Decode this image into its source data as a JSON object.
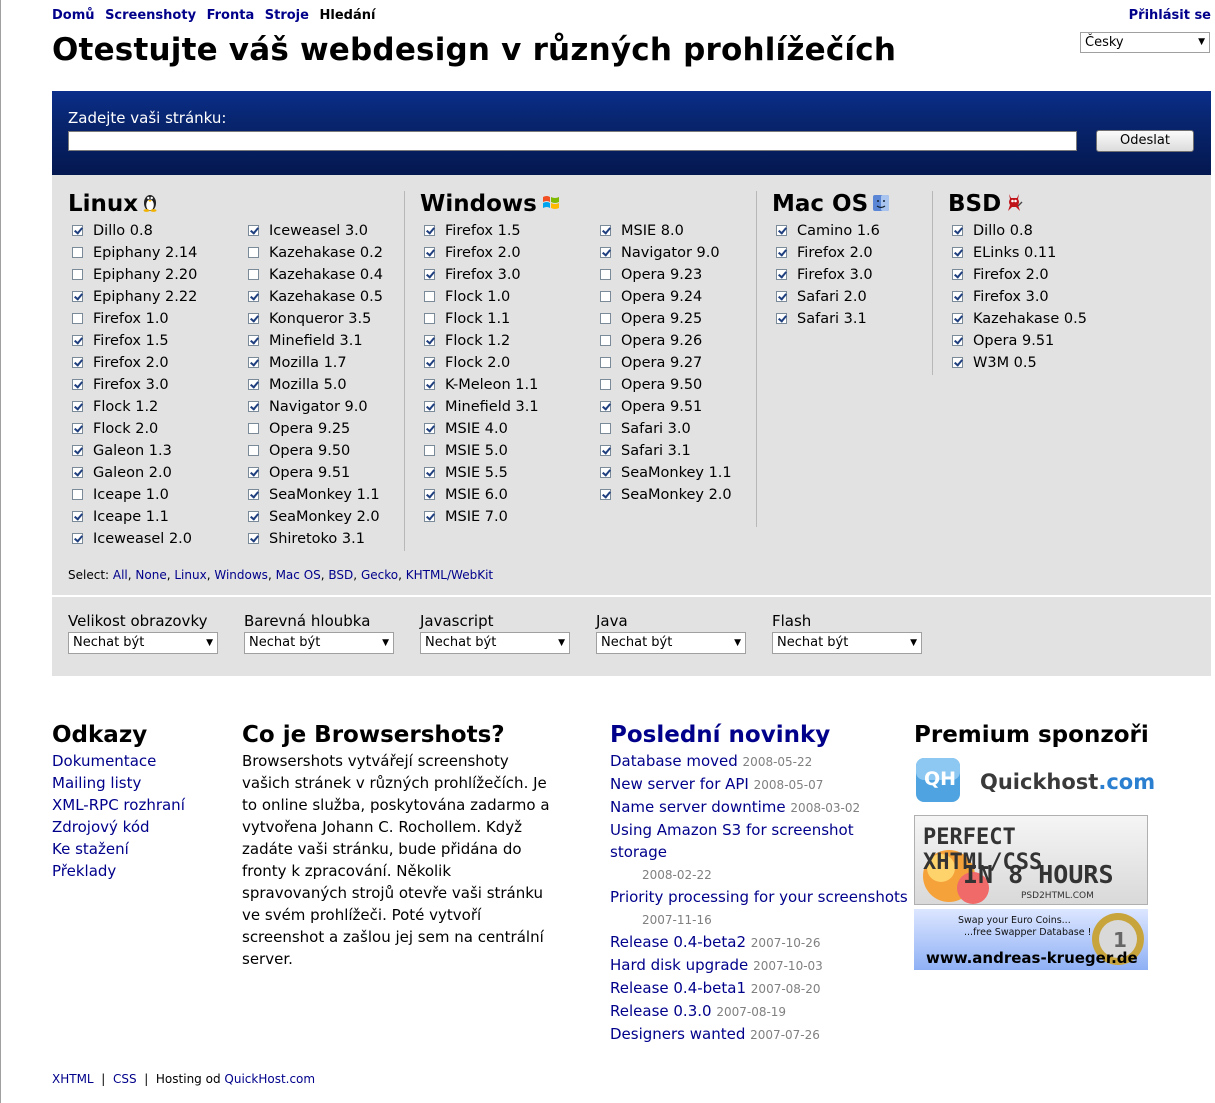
{
  "nav": {
    "items": [
      "Domů",
      "Screenshoty",
      "Fronta",
      "Stroje"
    ],
    "current": "Hledání",
    "login": "Přihlásit se"
  },
  "page_title": "Otestujte váš webdesign v různých prohlížečích",
  "language": {
    "selected": "Česky"
  },
  "url_form": {
    "label": "Zadejte vaši stránku:",
    "value": "",
    "submit": "Odeslat"
  },
  "platforms": {
    "linux": {
      "name": "Linux",
      "icon": "penguin-icon",
      "col1": [
        {
          "label": "Dillo 0.8",
          "checked": true
        },
        {
          "label": "Epiphany 2.14",
          "checked": false
        },
        {
          "label": "Epiphany 2.20",
          "checked": false
        },
        {
          "label": "Epiphany 2.22",
          "checked": true
        },
        {
          "label": "Firefox 1.0",
          "checked": false
        },
        {
          "label": "Firefox 1.5",
          "checked": true
        },
        {
          "label": "Firefox 2.0",
          "checked": true
        },
        {
          "label": "Firefox 3.0",
          "checked": true
        },
        {
          "label": "Flock 1.2",
          "checked": true
        },
        {
          "label": "Flock 2.0",
          "checked": true
        },
        {
          "label": "Galeon 1.3",
          "checked": true
        },
        {
          "label": "Galeon 2.0",
          "checked": true
        },
        {
          "label": "Iceape 1.0",
          "checked": false
        },
        {
          "label": "Iceape 1.1",
          "checked": true
        },
        {
          "label": "Iceweasel 2.0",
          "checked": true
        }
      ],
      "col2": [
        {
          "label": "Iceweasel 3.0",
          "checked": true
        },
        {
          "label": "Kazehakase 0.2",
          "checked": false
        },
        {
          "label": "Kazehakase 0.4",
          "checked": false
        },
        {
          "label": "Kazehakase 0.5",
          "checked": true
        },
        {
          "label": "Konqueror 3.5",
          "checked": true
        },
        {
          "label": "Minefield 3.1",
          "checked": true
        },
        {
          "label": "Mozilla 1.7",
          "checked": true
        },
        {
          "label": "Mozilla 5.0",
          "checked": true
        },
        {
          "label": "Navigator 9.0",
          "checked": true
        },
        {
          "label": "Opera 9.25",
          "checked": false
        },
        {
          "label": "Opera 9.50",
          "checked": false
        },
        {
          "label": "Opera 9.51",
          "checked": true
        },
        {
          "label": "SeaMonkey 1.1",
          "checked": true
        },
        {
          "label": "SeaMonkey 2.0",
          "checked": true
        },
        {
          "label": "Shiretoko 3.1",
          "checked": true
        }
      ]
    },
    "windows": {
      "name": "Windows",
      "icon": "windows-logo-icon",
      "col1": [
        {
          "label": "Firefox 1.5",
          "checked": true
        },
        {
          "label": "Firefox 2.0",
          "checked": true
        },
        {
          "label": "Firefox 3.0",
          "checked": true
        },
        {
          "label": "Flock 1.0",
          "checked": false
        },
        {
          "label": "Flock 1.1",
          "checked": false
        },
        {
          "label": "Flock 1.2",
          "checked": true
        },
        {
          "label": "Flock 2.0",
          "checked": true
        },
        {
          "label": "K-Meleon 1.1",
          "checked": true
        },
        {
          "label": "Minefield 3.1",
          "checked": true
        },
        {
          "label": "MSIE 4.0",
          "checked": true
        },
        {
          "label": "MSIE 5.0",
          "checked": false
        },
        {
          "label": "MSIE 5.5",
          "checked": true
        },
        {
          "label": "MSIE 6.0",
          "checked": true
        },
        {
          "label": "MSIE 7.0",
          "checked": true
        }
      ],
      "col2": [
        {
          "label": "MSIE 8.0",
          "checked": true
        },
        {
          "label": "Navigator 9.0",
          "checked": true
        },
        {
          "label": "Opera 9.23",
          "checked": false
        },
        {
          "label": "Opera 9.24",
          "checked": false
        },
        {
          "label": "Opera 9.25",
          "checked": false
        },
        {
          "label": "Opera 9.26",
          "checked": false
        },
        {
          "label": "Opera 9.27",
          "checked": false
        },
        {
          "label": "Opera 9.50",
          "checked": false
        },
        {
          "label": "Opera 9.51",
          "checked": true
        },
        {
          "label": "Safari 3.0",
          "checked": false
        },
        {
          "label": "Safari 3.1",
          "checked": true
        },
        {
          "label": "SeaMonkey 1.1",
          "checked": true
        },
        {
          "label": "SeaMonkey 2.0",
          "checked": true
        }
      ]
    },
    "mac": {
      "name": "Mac OS",
      "icon": "mac-finder-icon",
      "col1": [
        {
          "label": "Camino 1.6",
          "checked": true
        },
        {
          "label": "Firefox 2.0",
          "checked": true
        },
        {
          "label": "Firefox 3.0",
          "checked": true
        },
        {
          "label": "Safari 2.0",
          "checked": true
        },
        {
          "label": "Safari 3.1",
          "checked": true
        }
      ]
    },
    "bsd": {
      "name": "BSD",
      "icon": "bsd-daemon-icon",
      "col1": [
        {
          "label": "Dillo 0.8",
          "checked": true
        },
        {
          "label": "ELinks 0.11",
          "checked": true
        },
        {
          "label": "Firefox 2.0",
          "checked": true
        },
        {
          "label": "Firefox 3.0",
          "checked": true
        },
        {
          "label": "Kazehakase 0.5",
          "checked": true
        },
        {
          "label": "Opera 9.51",
          "checked": true
        },
        {
          "label": "W3M 0.5",
          "checked": true
        }
      ]
    }
  },
  "select_links": {
    "prefix": "Select:",
    "items": [
      "All",
      "None",
      "Linux",
      "Windows",
      "Mac OS",
      "BSD",
      "Gecko",
      "KHTML/WebKit"
    ]
  },
  "options": [
    {
      "label": "Velikost obrazovky",
      "value": "Nechat být"
    },
    {
      "label": "Barevná hloubka",
      "value": "Nechat být"
    },
    {
      "label": "Javascript",
      "value": "Nechat být"
    },
    {
      "label": "Java",
      "value": "Nechat být"
    },
    {
      "label": "Flash",
      "value": "Nechat být"
    }
  ],
  "links_section": {
    "title": "Odkazy",
    "items": [
      "Dokumentace",
      "Mailing listy",
      "XML-RPC rozhraní",
      "Zdrojový kód",
      "Ke stažení",
      "Překlady"
    ]
  },
  "about_section": {
    "title": "Co je Browsershots?",
    "text": "Browsershots vytvářejí screenshoty vašich stránek v různých prohlížečích. Je to online služba, poskytována zadarmo a vytvořena Johann C. Rochollem. Když zadáte vaši stránku, bude přidána do fronty k zpracování. Několik spravovaných strojů otevře vaši stránku ve svém prohlížeči. Poté vytvoří screenshot a zašlou jej sem na centrální server."
  },
  "news_section": {
    "title": "Poslední novinky",
    "items": [
      {
        "title": "Database moved",
        "date": "2008-05-22",
        "wrap": false
      },
      {
        "title": "New server for API",
        "date": "2008-05-07",
        "wrap": false
      },
      {
        "title": "Name server downtime",
        "date": "2008-03-02",
        "wrap": false
      },
      {
        "title": "Using Amazon S3 for screenshot storage",
        "date": "2008-02-22",
        "wrap": true
      },
      {
        "title": "Priority processing for your screenshots",
        "date": "2007-11-16",
        "wrap": true
      },
      {
        "title": "Release 0.4-beta2",
        "date": "2007-10-26",
        "wrap": false
      },
      {
        "title": "Hard disk upgrade",
        "date": "2007-10-03",
        "wrap": false
      },
      {
        "title": "Release 0.4-beta1",
        "date": "2007-08-20",
        "wrap": false
      },
      {
        "title": "Release 0.3.0",
        "date": "2007-08-19",
        "wrap": false
      },
      {
        "title": "Designers wanted",
        "date": "2007-07-26",
        "wrap": false
      }
    ]
  },
  "sponsors_section": {
    "title": "Premium sponzoři",
    "quickhost": {
      "badge": "QH",
      "name": "Quickhost",
      "tld": ".com"
    },
    "psd2html": {
      "line1": "PERFECT XHTML/CSS",
      "line2": "IN 8 HOURS",
      "line3": "PSD2HTML.COM"
    },
    "krueger": {
      "line1": "Swap your Euro Coins...",
      "line2": "...free Swapper Database !",
      "line3": "www.andreas-krueger.de"
    }
  },
  "footer": {
    "xhtml": "XHTML",
    "css": "CSS",
    "hosting": "Hosting od",
    "host": "QuickHost.com"
  },
  "colors": {
    "banner": "#08256f",
    "panel": "#e2e2e2",
    "link": "#00008b",
    "date": "#808080"
  }
}
